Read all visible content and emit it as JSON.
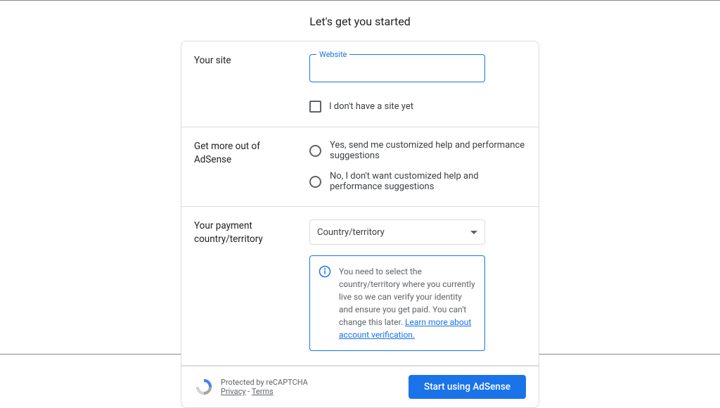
{
  "title": "Let's get you started",
  "site_section": {
    "label": "Your site",
    "website_field_label": "Website",
    "website_value": "",
    "no_site_label": "I don't have a site yet"
  },
  "adsense_section": {
    "label": "Get more out of AdSense",
    "option_yes": "Yes, send me customized help and performance suggestions",
    "option_no": "No, I don't want customized help and performance suggestions"
  },
  "country_section": {
    "label": "Your payment country/territory",
    "placeholder": "Country/territory",
    "info_text": "You need to select the country/territory where you currently live so we can verify your identity and ensure you get paid. You can't change this later. ",
    "info_link": "Learn more about account verification."
  },
  "footer": {
    "recaptcha_text": "Protected by reCAPTCHA",
    "privacy": "Privacy",
    "separator": " - ",
    "terms": "Terms",
    "submit_button": "Start using AdSense"
  },
  "colors": {
    "primary": "#1a73e8",
    "border": "#dadce0",
    "text": "#202124",
    "secondary_text": "#5f6368"
  }
}
